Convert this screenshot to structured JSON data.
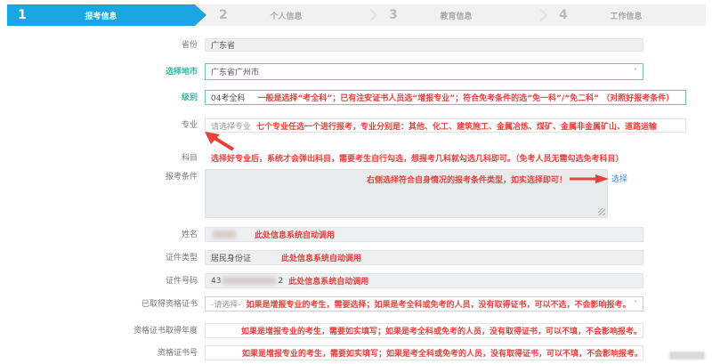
{
  "colors": {
    "accent_blue": "#1aa5e3",
    "teal": "#2eb8a2",
    "hint_red": "#e8413d",
    "link_blue": "#2d8cf0",
    "readonly_gray": "#edeff1"
  },
  "icons": {
    "chevron_down": "˅"
  },
  "steps": [
    {
      "number": "1",
      "label": "报考信息",
      "active": true
    },
    {
      "number": "2",
      "label": "个人信息",
      "active": false
    },
    {
      "number": "3",
      "label": "教育信息",
      "active": false
    },
    {
      "number": "4",
      "label": "工作信息",
      "active": false
    }
  ],
  "form": {
    "province": {
      "label": "省份",
      "value": "广东省"
    },
    "city": {
      "label": "选择地市",
      "value": "广东省广州市"
    },
    "level": {
      "label": "级别",
      "value": "04考全科",
      "hint": "一般是选择“考全科”；已有注安证书人员选“增报专业”；符合免考条件的选“免一科”/“免二科” （对照好报考条件）"
    },
    "major": {
      "label": "专业",
      "placeholder": "请选择专业",
      "hint": "七个专业任选一个进行报考，专业分别是：其他、化工、建筑施工、金属冶炼、煤矿、金属非金属矿山、道路运输"
    },
    "subject": {
      "label": "科目",
      "hint": "选择好专业后，系统才会弹出科目，需要考生自行勾选，想报考几科就勾选几科即可。（免考人员无需勾选免考科目）"
    },
    "conditions": {
      "label": "报考条件",
      "hint": "右侧选择符合自身情况的报考条件类型，如实选择即可！",
      "link": "选择"
    },
    "name": {
      "label": "姓名",
      "hint": "此处信息系统自动调用"
    },
    "id_type": {
      "label": "证件类型",
      "value": "居民身份证",
      "hint": "此处信息系统自动调用"
    },
    "id_number": {
      "label": "证件号码",
      "value_prefix": "43",
      "value_suffix": "2",
      "hint": "此处信息系统自动调用"
    },
    "certificate": {
      "label": "已取得资格证书",
      "value": "-请选择-",
      "hint": "如果是增报专业的考生，需要选择；如果是考全科或免考的人员，没有取得证书，可以不选，不会影响报考。"
    },
    "cert_year": {
      "label": "资格证书取得年度",
      "hint": "如果是增报专业的考生，需要如实填写；如果是考全科或免考的人员，没有取得证书，可以不填，不会影响报考。"
    },
    "cert_number": {
      "label": "资格证书号",
      "hint": "如果是增报专业的考生，需要如实填写；如果是考全科或免考的人员，没有取得证书，可以不填，不会影响报考。"
    }
  }
}
